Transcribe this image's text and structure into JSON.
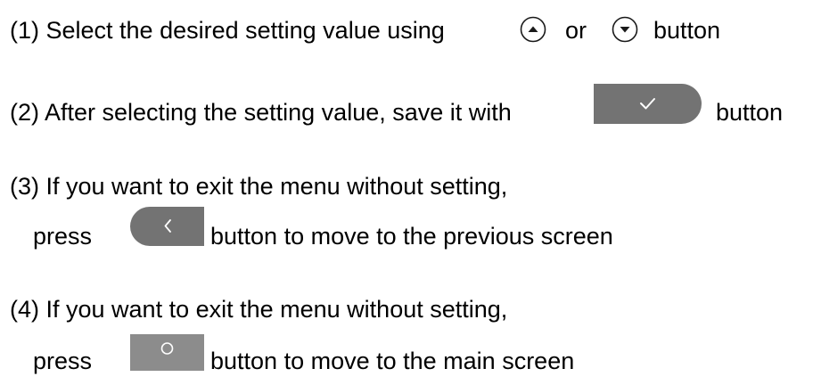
{
  "steps": {
    "s1": {
      "text_a": "(1) Select the desired setting value using",
      "text_b": "or",
      "text_c": "button",
      "up_icon": "arrow-up-circle-icon",
      "down_icon": "arrow-down-circle-icon"
    },
    "s2": {
      "text_a": "(2) After selecting the setting value, save it with",
      "text_b": "button",
      "button_icon": "checkmark-icon",
      "button_color": "#737373"
    },
    "s3": {
      "line1": "(3) If you want to exit the menu without setting,",
      "text_a": "press",
      "text_b": "button to move to the previous screen",
      "button_icon": "chevron-left-icon",
      "button_color": "#737373"
    },
    "s4": {
      "line1": "(4) If you want to exit the menu without setting,",
      "text_a": "press",
      "text_b": "button to move to the main screen",
      "button_icon": "circle-icon",
      "button_color": "#8c8c8c"
    }
  },
  "colors": {
    "text": "#000000",
    "icon_glyph": "#ffffff"
  }
}
